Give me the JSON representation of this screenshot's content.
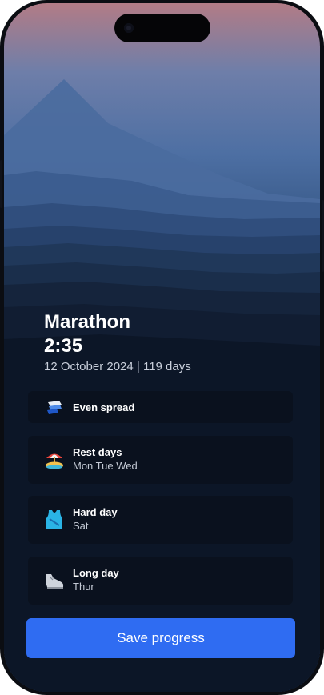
{
  "race": {
    "name": "Marathon",
    "target_time": "2:35",
    "date_info": "12 October 2024 | 119 days"
  },
  "options": [
    {
      "icon": "even-spread-icon",
      "label": "Even spread",
      "value": ""
    },
    {
      "icon": "beach-umbrella-icon",
      "label": "Rest days",
      "value": "Mon Tue Wed"
    },
    {
      "icon": "running-vest-icon",
      "label": "Hard day",
      "value": "Sat"
    },
    {
      "icon": "running-shoe-icon",
      "label": "Long day",
      "value": "Thur"
    }
  ],
  "actions": {
    "save_label": "Save progress"
  },
  "colors": {
    "accent": "#2f6cf2",
    "card_bg": "#0e1420",
    "text_primary": "#ffffff",
    "text_secondary": "#c3c9d4"
  }
}
